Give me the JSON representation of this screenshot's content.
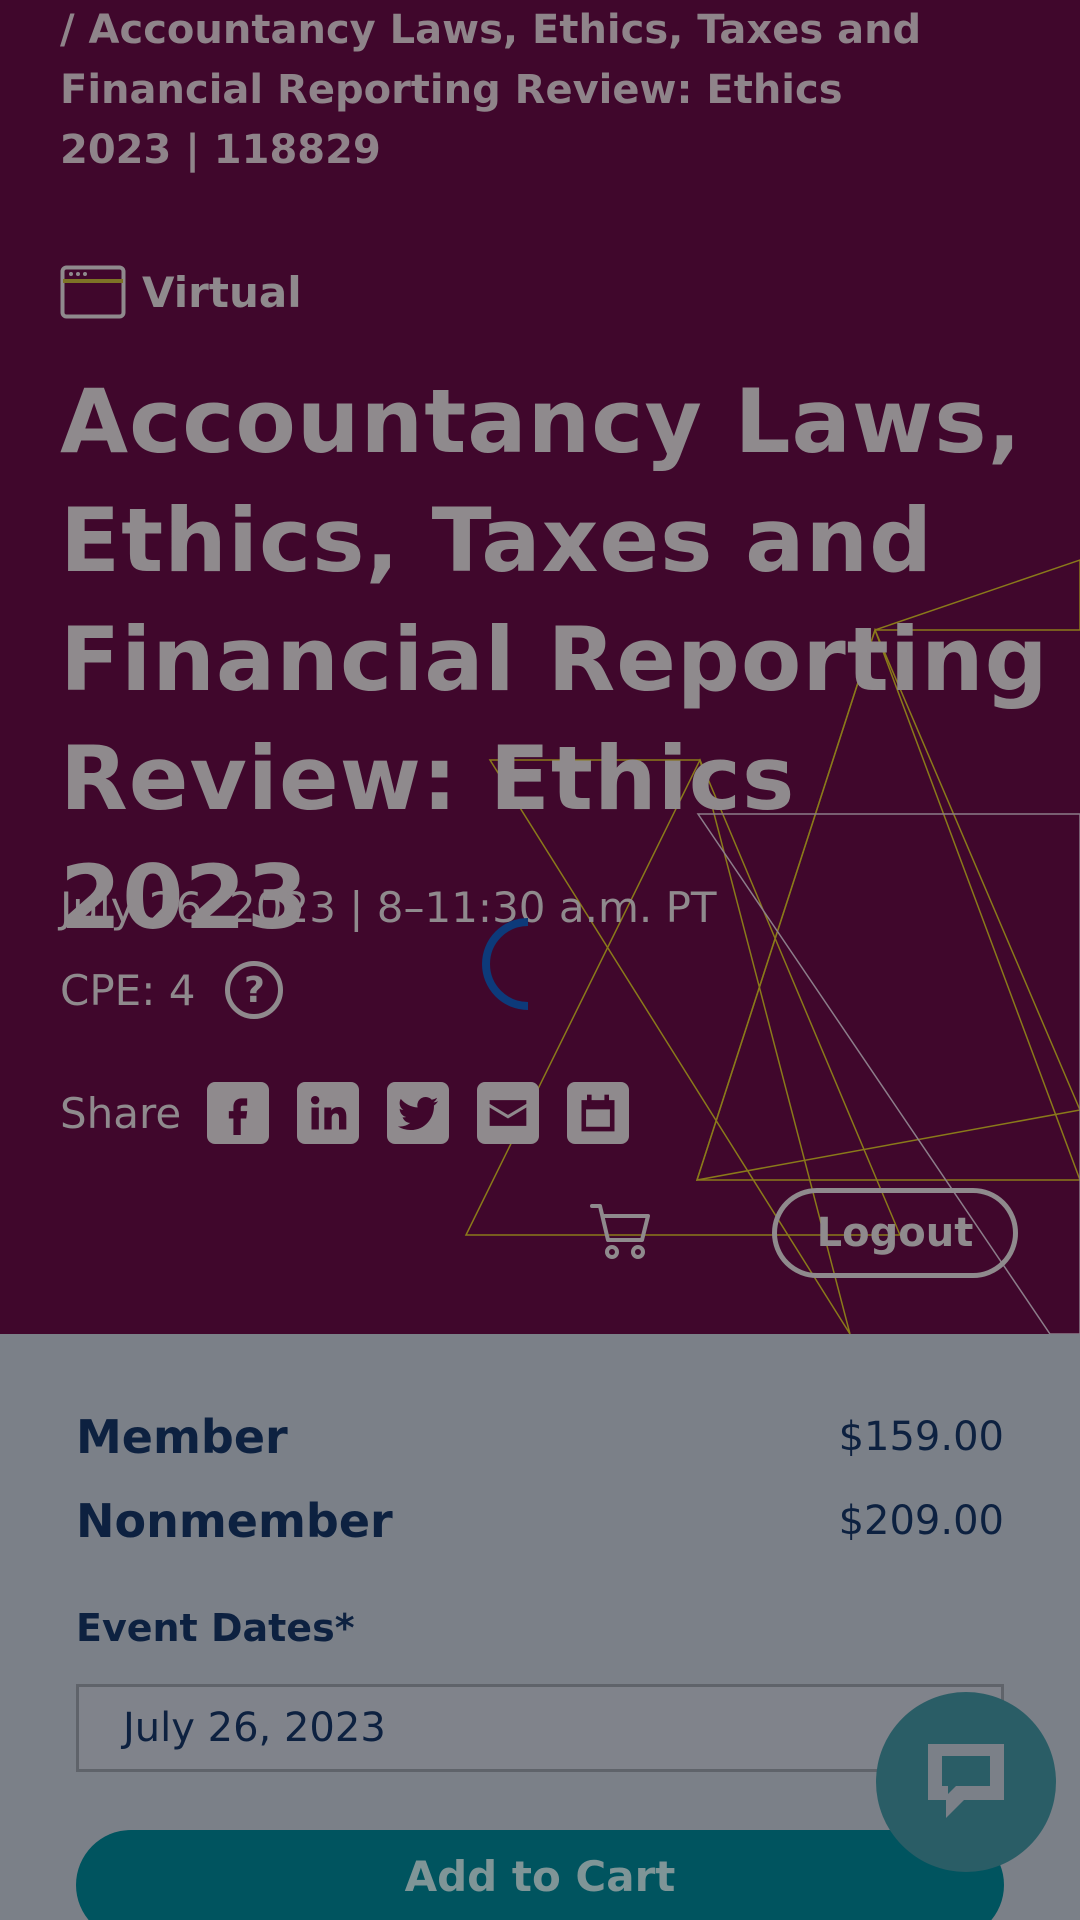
{
  "breadcrumb": {
    "text": "/ Accountancy Laws, Ethics, Taxes and Financial Reporting Review: Ethics 2023 | 118829"
  },
  "event": {
    "format_icon": "browser-window-icon",
    "format_label": "Virtual",
    "title": "Accountancy Laws, Ethics, Taxes and Financial Reporting Review: Ethics 2023",
    "datetime": "July 26, 2023 | 8–11:30 a.m. PT",
    "cpe": "CPE: 4",
    "help_glyph": "?"
  },
  "share": {
    "label": "Share",
    "icons": [
      "facebook-icon",
      "linkedin-icon",
      "twitter-icon",
      "email-icon",
      "calendar-icon"
    ]
  },
  "header": {
    "cart_icon": "cart-icon",
    "logout_label": "Logout"
  },
  "pricing": [
    {
      "label": "Member",
      "value": "$159.00"
    },
    {
      "label": "Nonmember",
      "value": "$209.00"
    }
  ],
  "registration": {
    "dates_label": "Event Dates*",
    "selected_date": "July 26, 2023",
    "add_to_cart_label": "Add to Cart"
  },
  "chat": {
    "icon": "chat-bubble-icon"
  },
  "colors": {
    "hero_bg": "#40072c",
    "overlay": "#7b8088",
    "primary_text": "#0d2140",
    "button_teal": "#00545f",
    "chat_button": "#2a5d66",
    "spinner": "#0d3a7a",
    "deco_gold": "#8a7a1a"
  }
}
